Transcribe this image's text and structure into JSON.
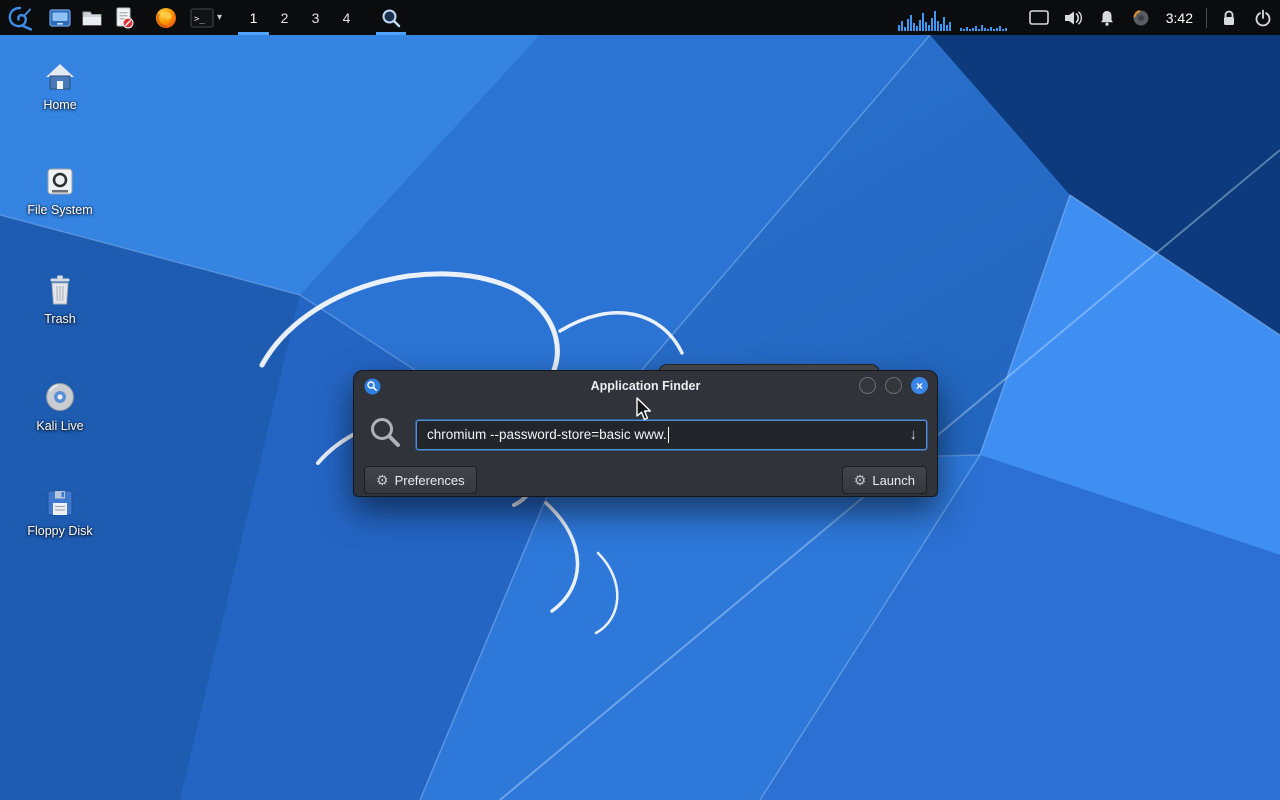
{
  "panel": {
    "workspaces": [
      "1",
      "2",
      "3",
      "4"
    ],
    "active_workspace_index": 0,
    "clock": "3:42",
    "graphs": [
      {
        "bars": [
          6,
          10,
          4,
          12,
          16,
          8,
          5,
          11,
          18,
          9,
          6,
          13,
          20,
          10,
          7,
          14,
          6,
          9
        ]
      },
      {
        "bars": [
          3,
          2,
          4,
          2,
          3,
          5,
          2,
          6,
          3,
          2,
          4,
          2,
          3,
          5,
          2,
          3
        ]
      }
    ],
    "glyphs": {
      "chevron_down": "▾",
      "terminal_prompt": ">_"
    }
  },
  "desktop": {
    "icons": [
      {
        "label": "Home"
      },
      {
        "label": "File System"
      },
      {
        "label": "Trash"
      },
      {
        "label": "Kali Live"
      },
      {
        "label": "Floppy Disk"
      }
    ]
  },
  "finder": {
    "title": "Application Finder",
    "query": "chromium --password-store=basic www.",
    "glyphs": {
      "dropdown_arrow": "↓",
      "close": "×",
      "gear": "⚙",
      "launch": "⚙"
    },
    "buttons": {
      "preferences": "Preferences",
      "launch": "Launch"
    }
  }
}
